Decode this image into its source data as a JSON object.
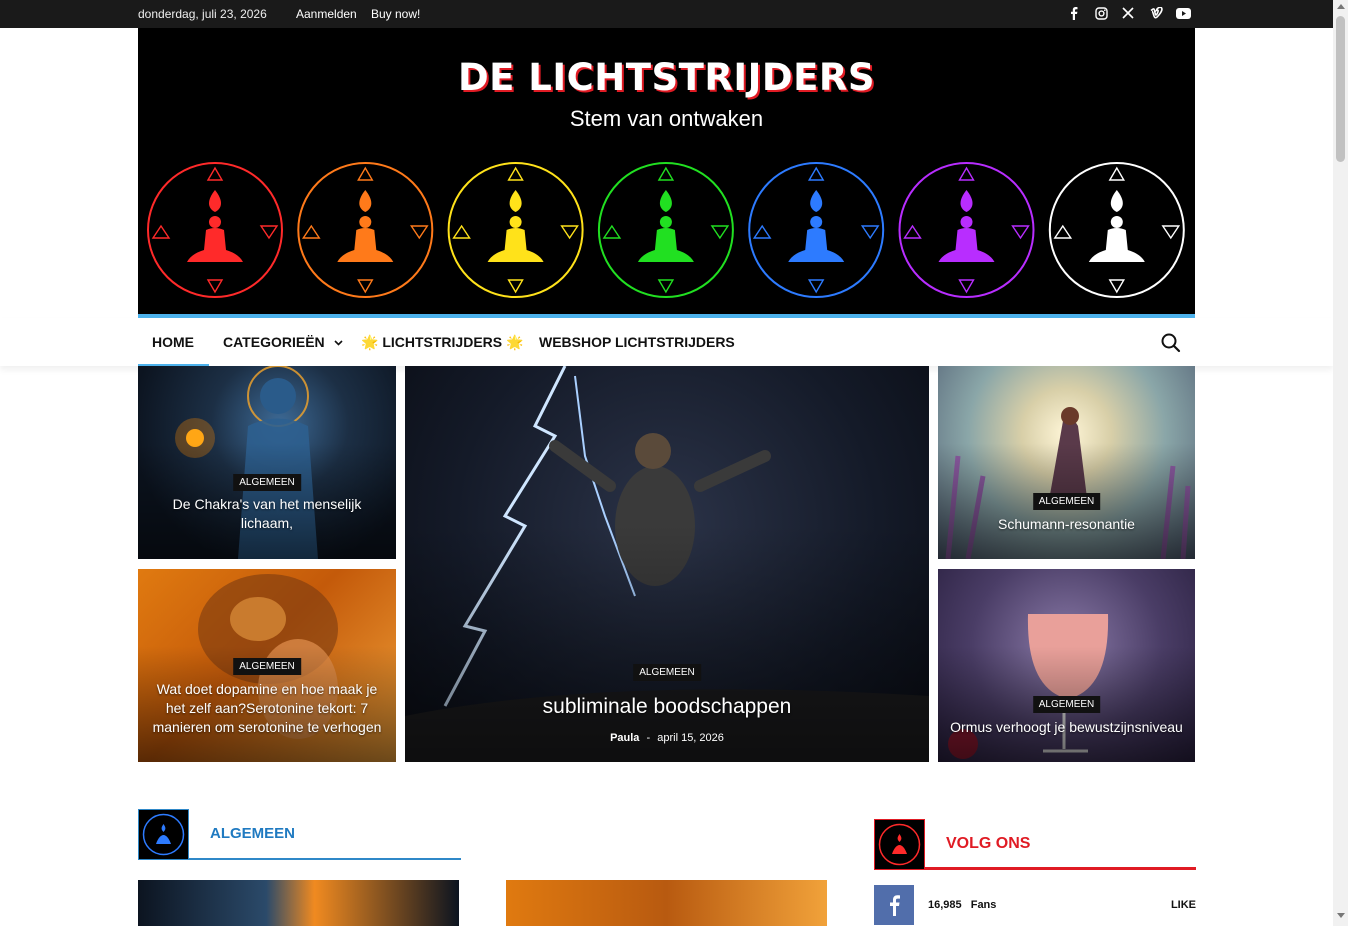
{
  "topbar": {
    "date": "donderdag, juli 23, 2026",
    "login": "Aanmelden",
    "buy": "Buy now!",
    "social_icons": [
      "facebook-icon",
      "instagram-icon",
      "x-icon",
      "vimeo-icon",
      "youtube-icon"
    ]
  },
  "header": {
    "title": "DE LICHTSTRIJDERS",
    "tagline": "Stem van ontwaken",
    "chakra_colors": [
      "#ff2a2a",
      "#ff7a1a",
      "#ffe21a",
      "#21e021",
      "#2d7bff",
      "#b82dff",
      "#ffffff"
    ]
  },
  "nav": {
    "items": [
      {
        "label": "HOME",
        "active": true
      },
      {
        "label": "CATEGORIEËN",
        "dropdown": true
      },
      {
        "label": "🌟 LICHTSTRIJDERS 🌟"
      },
      {
        "label": "WEBSHOP LICHTSTRIJDERS"
      }
    ],
    "search_icon": "search-icon"
  },
  "featured": {
    "tiles": [
      {
        "category": "ALGEMEEN",
        "title": "De Chakra's van het menselijk lichaam,"
      },
      {
        "category": "ALGEMEEN",
        "title": "Wat doet dopamine en hoe maak je het zelf aan?Serotonine tekort: 7 manieren om serotonine te verhogen"
      },
      {
        "category": "ALGEMEEN",
        "title": "subliminale boodschappen",
        "author": "Paula",
        "separator": "-",
        "date": "april 15, 2026"
      },
      {
        "category": "ALGEMEEN",
        "title": "Schumann-resonantie"
      },
      {
        "category": "ALGEMEEN",
        "title": "Ormus verhoogt je bewustzijnsniveau"
      }
    ]
  },
  "section": {
    "title": "ALGEMEEN"
  },
  "follow": {
    "title": "VOLG ONS",
    "facebook": {
      "count": "16,985",
      "unit": "Fans",
      "action": "LIKE"
    }
  },
  "colors": {
    "accent": "#4db2ec",
    "red": "#e01b24",
    "section_blue": "#1f7ac1"
  }
}
